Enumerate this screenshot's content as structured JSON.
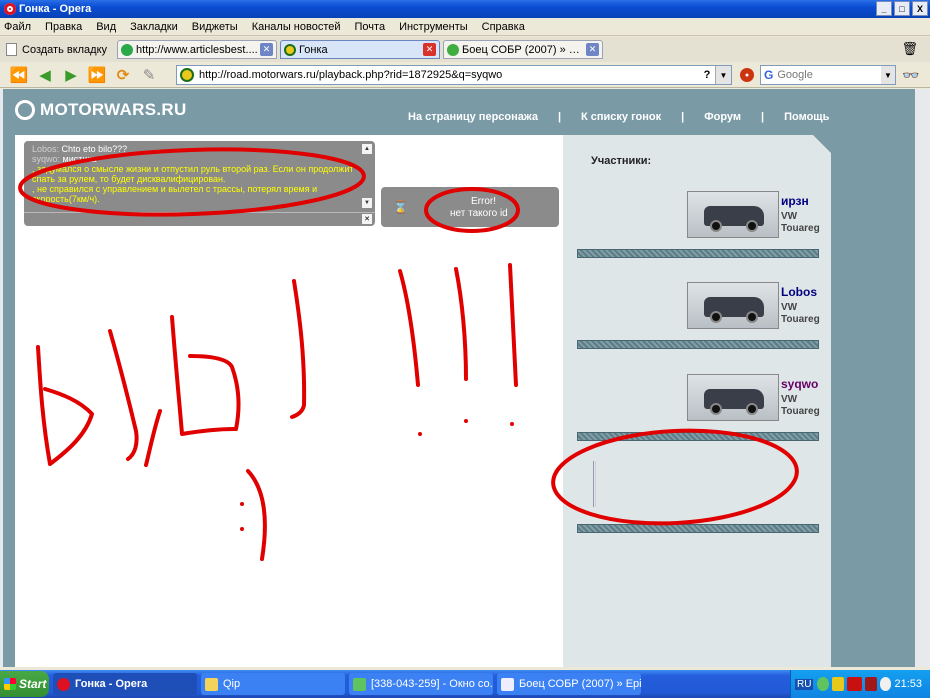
{
  "window": {
    "title": "Гонка - Opera",
    "minimize": "_",
    "maximize": "□",
    "close": "X"
  },
  "menu": [
    "Файл",
    "Правка",
    "Вид",
    "Закладки",
    "Виджеты",
    "Каналы новостей",
    "Почта",
    "Инструменты",
    "Справка"
  ],
  "tabs": {
    "new_tab": "Создать вкладку",
    "items": [
      {
        "label": "http://www.articlesbest....",
        "active": false
      },
      {
        "label": "Гонка",
        "active": true
      },
      {
        "label": "Боец СОБР (2007) » Epi...",
        "active": false
      }
    ]
  },
  "nav": {
    "url": "http://road.motorwars.ru/playback.php?rid=1872925&q=syqwo",
    "help": "?",
    "search_placeholder": "Google",
    "search_engine_glyph": "G"
  },
  "site": {
    "logo": "MOTORWARS.RU",
    "links": [
      "На страницу персонажа",
      "К списку гонок",
      "Форум",
      "Помощь"
    ],
    "separator": "|"
  },
  "chat": {
    "lines": [
      {
        "nick": "Lobos:",
        "msg": "Chto eto bilo???"
      },
      {
        "nick": "syqwo:",
        "msg": "мистика"
      }
    ],
    "system": [
      ", задумался о смысле жизни и отпустил руль второй раз. Если он продолжит спать за рулем, то будет дисквалифицирован.",
      ", не справился с управлением и вылетел с трассы, потерял время и скорость(7км/ч)."
    ]
  },
  "error": {
    "title": "Error!",
    "text": "нет такого id",
    "icon": "⌛"
  },
  "participants": {
    "heading": "Участники:",
    "racers": [
      {
        "name": "ирзн",
        "model": "VW Touareg",
        "color": "#000080"
      },
      {
        "name": "Lobos",
        "model": "VW Touareg",
        "color": "#000080"
      },
      {
        "name": "syqwo",
        "model": "VW Touareg",
        "color": "#660066"
      }
    ]
  },
  "taskbar": {
    "start": "Start",
    "tasks": [
      "Гонка - Opera",
      "Qip",
      "[338-043-259] - Окно со...",
      "Боец СОБР (2007) » Epi..."
    ],
    "lang": "RU",
    "clock": "21:53"
  },
  "colors": {
    "site_frame": "#7a9aa6",
    "chat_yellow": "#ffff00",
    "scribble_red": "#e00000"
  }
}
